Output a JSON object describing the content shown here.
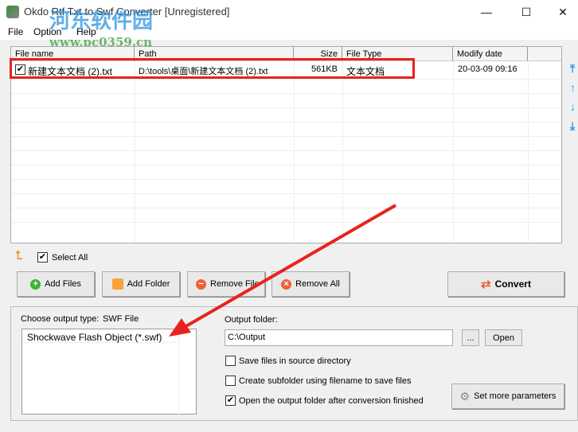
{
  "window": {
    "title": "Okdo Rtf Txt to Swf Converter [Unregistered]",
    "minimize": "—",
    "maximize": "☐",
    "close": "✕"
  },
  "watermark": {
    "text": "河东软件园",
    "url": "www.pc0359.cn"
  },
  "menu": [
    "File",
    "Option",
    "Help"
  ],
  "table": {
    "columns": [
      "File name",
      "Path",
      "Size",
      "File Type",
      "Modify date"
    ],
    "rows": [
      {
        "checked": true,
        "name": "新建文本文档 (2).txt",
        "path": "D:\\tools\\桌面\\新建文本文档 (2).txt",
        "size": "561KB",
        "type": "文本文档",
        "date": "20-03-09 09:16"
      }
    ]
  },
  "select_all": {
    "label": "Select All",
    "checked": true
  },
  "buttons": {
    "add_files": "Add Files",
    "add_folder": "Add Folder",
    "remove_file": "Remove File",
    "remove_all": "Remove All",
    "convert": "Convert",
    "browse": "...",
    "open": "Open",
    "set_params": "Set more parameters"
  },
  "output": {
    "type_label": "Choose output type:",
    "type_value": "SWF File",
    "types": [
      "Shockwave Flash Object (*.swf)"
    ],
    "folder_label": "Output folder:",
    "folder_value": "C:\\Output"
  },
  "options": [
    {
      "label": "Save files in source directory",
      "checked": false
    },
    {
      "label": "Create subfolder using filename to save files",
      "checked": false
    },
    {
      "label": "Open the output folder after conversion finished",
      "checked": true
    }
  ],
  "colors": {
    "highlight": "#e8231f",
    "accent": "#1e9be8"
  }
}
